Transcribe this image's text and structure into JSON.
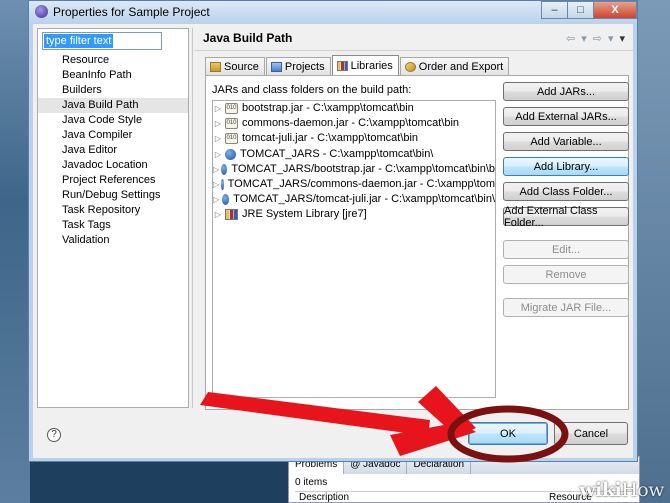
{
  "window": {
    "title": "Properties for Sample Project",
    "buttons": [
      "–",
      "□",
      "X"
    ]
  },
  "filter": {
    "value": "type filter text"
  },
  "tree": {
    "items": [
      "Resource",
      "BeanInfo Path",
      "Builders",
      "Java Build Path",
      "Java Code Style",
      "Java Compiler",
      "Java Editor",
      "Javadoc Location",
      "Project References",
      "Run/Debug Settings",
      "Task Repository",
      "Task Tags",
      "Validation"
    ],
    "selected": "Java Build Path"
  },
  "page": {
    "title": "Java Build Path",
    "nav": [
      "⇦",
      "▾",
      "⇨",
      "▾",
      "▾"
    ]
  },
  "tabs": [
    {
      "label": "Source",
      "icon": "source-folder-icon",
      "active": false
    },
    {
      "label": "Projects",
      "icon": "projects-icon",
      "active": false
    },
    {
      "label": "Libraries",
      "icon": "libraries-icon",
      "active": true
    },
    {
      "label": "Order and Export",
      "icon": "order-export-icon",
      "active": false
    }
  ],
  "libraries": {
    "label": "JARs and class folders on the build path:",
    "entries": [
      {
        "icon": "jar",
        "text": "bootstrap.jar - C:\\xampp\\tomcat\\bin"
      },
      {
        "icon": "jar",
        "text": "commons-daemon.jar - C:\\xampp\\tomcat\\bin"
      },
      {
        "icon": "jar",
        "text": "tomcat-juli.jar - C:\\xampp\\tomcat\\bin"
      },
      {
        "icon": "var",
        "text": "TOMCAT_JARS - C:\\xampp\\tomcat\\bin\\"
      },
      {
        "icon": "var",
        "text": "TOMCAT_JARS/bootstrap.jar - C:\\xampp\\tomcat\\bin\\b"
      },
      {
        "icon": "var",
        "text": "TOMCAT_JARS/commons-daemon.jar - C:\\xampp\\tom"
      },
      {
        "icon": "var",
        "text": "TOMCAT_JARS/tomcat-juli.jar - C:\\xampp\\tomcat\\bin\\"
      },
      {
        "icon": "lib",
        "text": "JRE System Library [jre7]"
      }
    ]
  },
  "actions": [
    {
      "label": "Add JARs...",
      "state": "normal"
    },
    {
      "label": "Add External JARs...",
      "state": "normal"
    },
    {
      "label": "Add Variable...",
      "state": "normal"
    },
    {
      "label": "Add Library...",
      "state": "hot"
    },
    {
      "label": "Add Class Folder...",
      "state": "normal"
    },
    {
      "label": "Add External Class Folder...",
      "state": "normal"
    },
    {
      "label": "Edit...",
      "state": "disabled"
    },
    {
      "label": "Remove",
      "state": "disabled"
    },
    {
      "label": "Migrate JAR File...",
      "state": "disabled"
    }
  ],
  "footer": {
    "help": "?",
    "ok": "OK",
    "cancel": "Cancel"
  },
  "background_view": {
    "tabs": [
      "Problems",
      "@ Javadoc",
      "Declaration"
    ],
    "count": "0 items",
    "columns": [
      "Description",
      "Resource"
    ]
  },
  "annotation": {
    "color": "#e8141b",
    "ellipse_color": "#7a1010"
  },
  "watermark": {
    "wiki": "wiki",
    "how": "How"
  }
}
